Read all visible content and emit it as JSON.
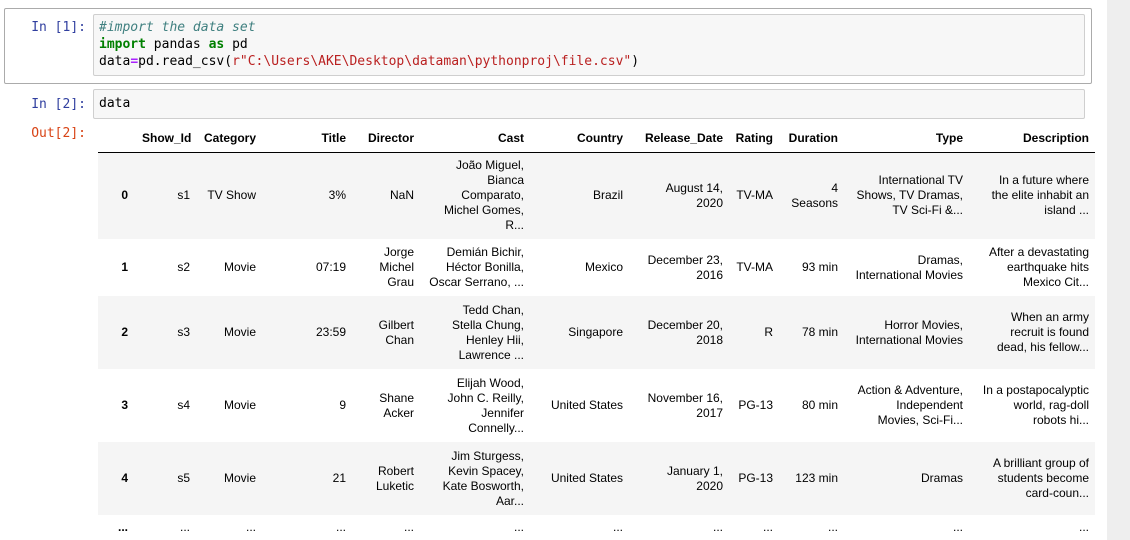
{
  "cells": [
    {
      "prompt": "In [1]:",
      "code_lines": [
        {
          "comment": "#import the data set"
        },
        {
          "kw": "import",
          "rest1": " pandas ",
          "kw2": "as",
          "rest2": " pd"
        },
        {
          "pre": "data",
          "op": "=",
          "mid": "pd.read_csv(",
          "str": "r\"C:\\Users\\AKE\\Desktop\\dataman\\pythonproj\\file.csv\"",
          "post": ")"
        }
      ]
    },
    {
      "prompt": "In [2]:",
      "code": "data",
      "out_prompt": "Out[2]:"
    }
  ],
  "dataframe": {
    "columns": [
      "",
      "Show_Id",
      "Category",
      "Title",
      "Director",
      "Cast",
      "Country",
      "Release_Date",
      "Rating",
      "Duration",
      "Type",
      "Description"
    ],
    "rows": [
      {
        "index": "0",
        "cells": [
          "s1",
          "TV Show",
          "3%",
          "NaN",
          "João Miguel,\nBianca\nComparato,\nMichel Gomes,\nR...",
          "Brazil",
          "August 14,\n2020",
          "TV-MA",
          "4\nSeasons",
          "International TV\nShows, TV Dramas,\nTV Sci-Fi &...",
          "In a future where\nthe elite inhabit an\nisland ..."
        ]
      },
      {
        "index": "1",
        "cells": [
          "s2",
          "Movie",
          "07:19",
          "Jorge\nMichel\nGrau",
          "Demián Bichir,\nHéctor Bonilla,\nOscar Serrano, ...",
          "Mexico",
          "December 23,\n2016",
          "TV-MA",
          "93 min",
          "Dramas,\nInternational Movies",
          "After a devastating\nearthquake hits\nMexico Cit..."
        ]
      },
      {
        "index": "2",
        "cells": [
          "s3",
          "Movie",
          "23:59",
          "Gilbert\nChan",
          "Tedd Chan,\nStella Chung,\nHenley Hii,\nLawrence ...",
          "Singapore",
          "December 20,\n2018",
          "R",
          "78 min",
          "Horror Movies,\nInternational Movies",
          "When an army\nrecruit is found\ndead, his fellow..."
        ]
      },
      {
        "index": "3",
        "cells": [
          "s4",
          "Movie",
          "9",
          "Shane\nAcker",
          "Elijah Wood,\nJohn C. Reilly,\nJennifer\nConnelly...",
          "United States",
          "November 16,\n2017",
          "PG-13",
          "80 min",
          "Action & Adventure,\nIndependent\nMovies, Sci-Fi...",
          "In a postapocalyptic\nworld, rag-doll\nrobots hi..."
        ]
      },
      {
        "index": "4",
        "cells": [
          "s5",
          "Movie",
          "21",
          "Robert\nLuketic",
          "Jim Sturgess,\nKevin Spacey,\nKate Bosworth,\nAar...",
          "United States",
          "January 1,\n2020",
          "PG-13",
          "123 min",
          "Dramas",
          "A brilliant group of\nstudents become\ncard-coun..."
        ]
      },
      {
        "index": "...",
        "cells": [
          "...",
          "...",
          "...",
          "...",
          "...",
          "...",
          "...",
          "...",
          "...",
          "...",
          "..."
        ]
      }
    ]
  }
}
